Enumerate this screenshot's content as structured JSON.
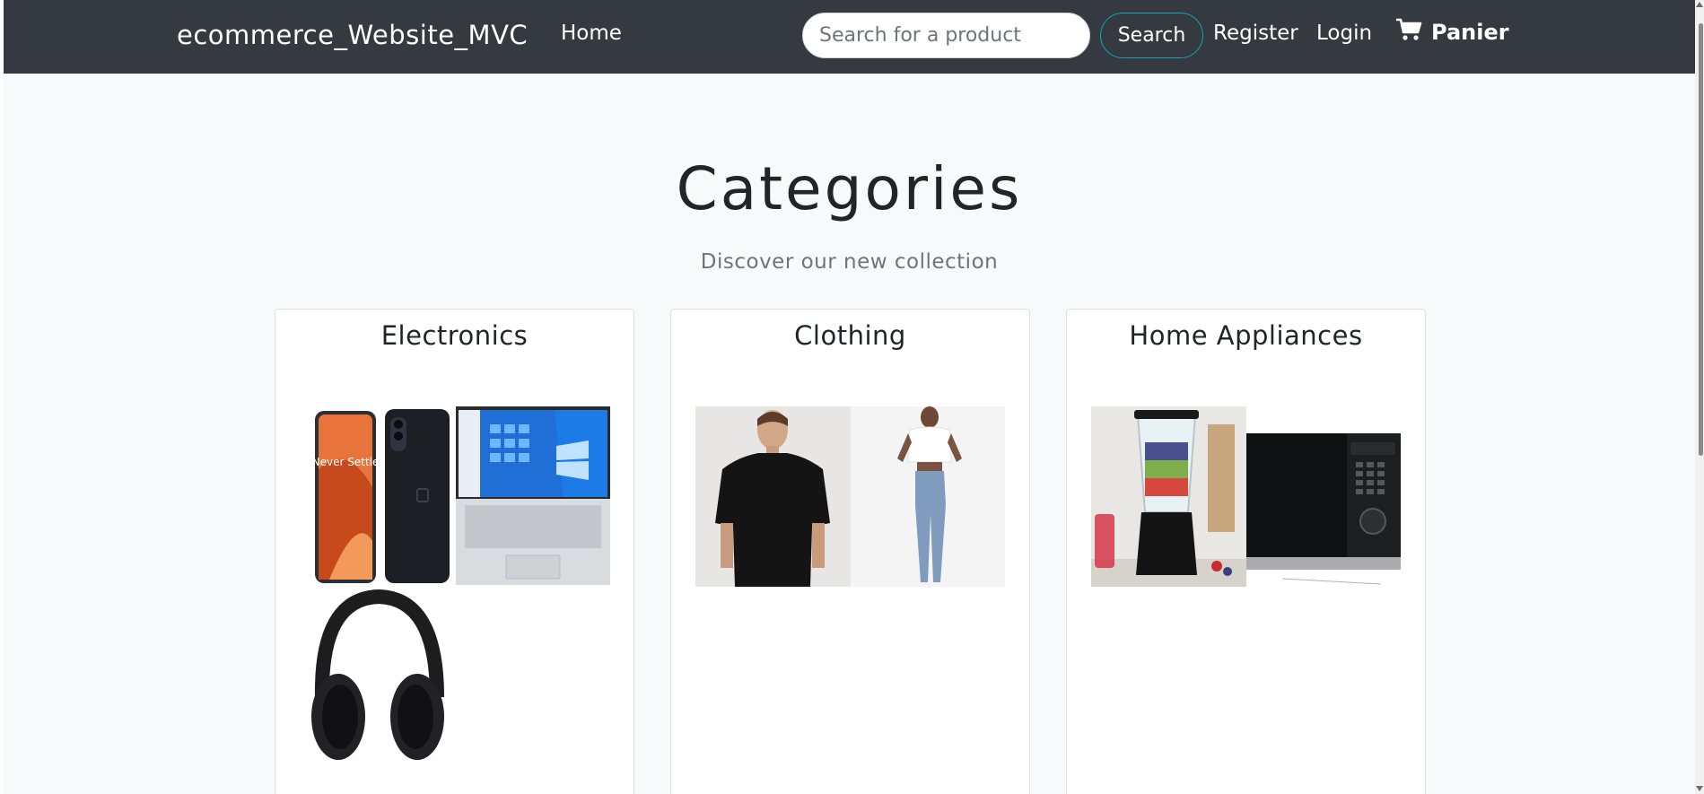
{
  "navbar": {
    "brand": "ecommerce_Website_MVC",
    "home": "Home",
    "search_placeholder": "Search for a product",
    "search_button": "Search",
    "register": "Register",
    "login": "Login",
    "cart": "Panier",
    "cart_icon": "shopping-cart-icon",
    "background": "#343a40"
  },
  "main": {
    "title": "Categories",
    "subtitle": "Discover our new collection"
  },
  "categories": [
    {
      "name": "Electronics",
      "images": [
        "smartphone-image",
        "laptop-image",
        "headphones-image"
      ],
      "phone_screen_text": "Never Settle"
    },
    {
      "name": "Clothing",
      "images": [
        "black-tshirt-image",
        "jeans-outfit-image"
      ]
    },
    {
      "name": "Home Appliances",
      "images": [
        "blender-image",
        "microwave-image"
      ]
    }
  ]
}
